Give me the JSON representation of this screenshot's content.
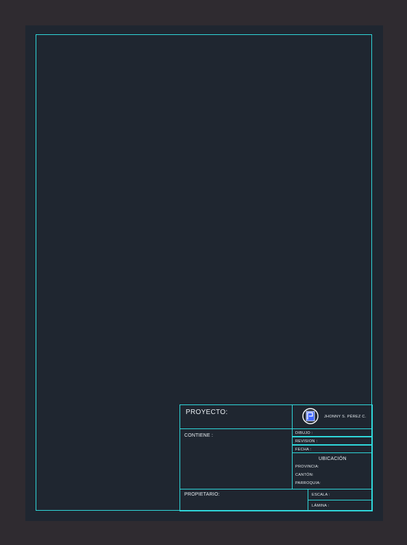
{
  "title_block": {
    "proyecto_label": "PROYECTO:",
    "author": "JHONNY S. PÉREZ C.",
    "contiene_label": "CONTIENE :",
    "dibujo_label": "DIBUJO :",
    "revision_label": "REVISION :",
    "fecha_label": "FECHA :",
    "ubicacion_label": "UBICACIÓN",
    "provincia_label": "PROVINCIA:",
    "canton_label": "CANTÓN:",
    "parroquia_label": "PARROQUIA:",
    "propietario_label": "PROPIETARIO:",
    "escala_label": "ESCALA :",
    "lamina_label": "LÁMINA :"
  },
  "colors": {
    "background": "#2f2b30",
    "sheet": "#1f2630",
    "line": "#2fd9dc",
    "text": "#e9eef2",
    "logo": "#3f66ff"
  }
}
